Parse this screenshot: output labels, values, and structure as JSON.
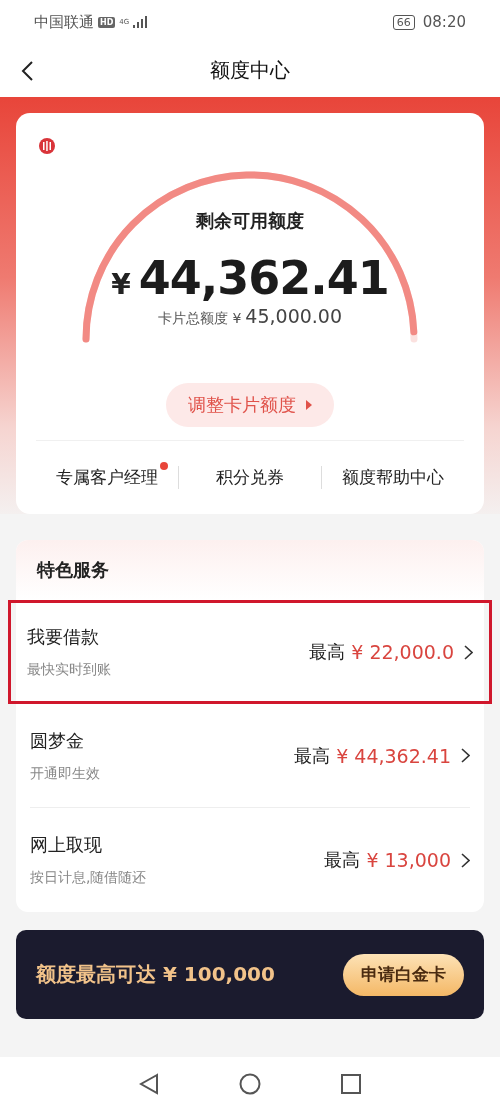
{
  "status_bar": {
    "carrier": "中国联通",
    "hd": "HD",
    "network": "4G",
    "battery": "66",
    "time": "08:20"
  },
  "header": {
    "title": "额度中心"
  },
  "credit_card": {
    "gauge": {
      "level": 0.986
    },
    "label": "剩余可用额度",
    "currency": "¥",
    "amount": "44,362.41",
    "total_label": "卡片总额度 ¥",
    "total": "45,000.00",
    "adjust_button": "调整卡片额度",
    "links": [
      {
        "label": "专属客户经理",
        "dot": true
      },
      {
        "label": "积分兑券",
        "dot": false
      },
      {
        "label": "额度帮助中心",
        "dot": false
      }
    ]
  },
  "services": {
    "title": "特色服务",
    "items": [
      {
        "name": "我要借款",
        "desc": "最快实时到账",
        "prefix": "最高",
        "amount": "¥ 22,000.0",
        "highlighted": true
      },
      {
        "name": "圆梦金",
        "desc": "开通即生效",
        "prefix": "最高",
        "amount": "¥ 44,362.41",
        "highlighted": false
      },
      {
        "name": "网上取现",
        "desc": "按日计息,随借随还",
        "prefix": "最高",
        "amount": "¥ 13,000",
        "highlighted": false
      }
    ]
  },
  "banner": {
    "text": "额度最高可达 ¥ 100,000",
    "button": "申请白金卡"
  }
}
